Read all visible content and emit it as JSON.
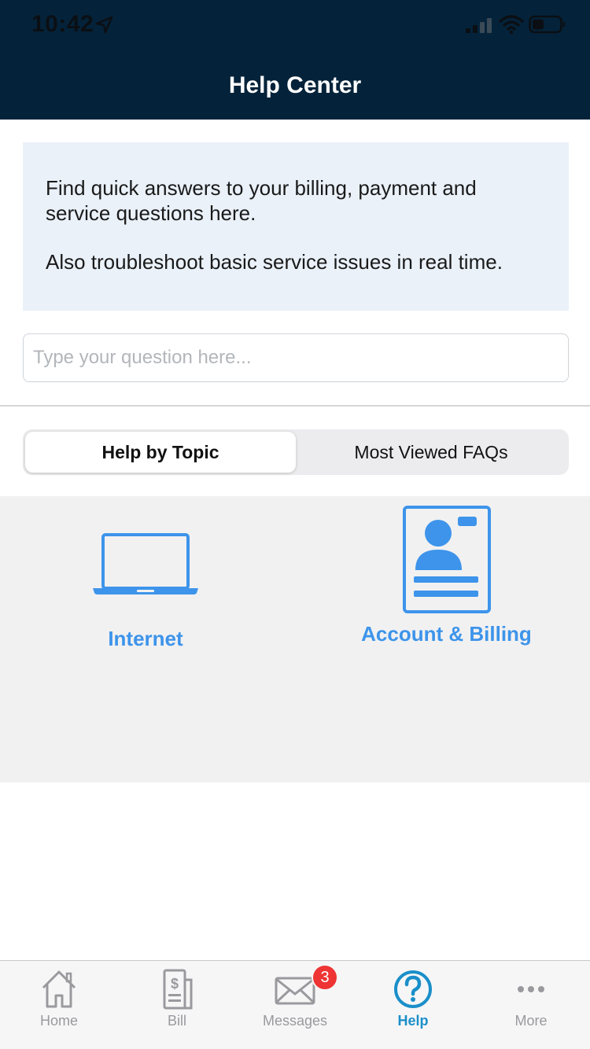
{
  "status_bar": {
    "time": "10:42",
    "icons": [
      "location-arrow-icon",
      "cellular-signal-icon",
      "wifi-icon",
      "battery-icon"
    ]
  },
  "header": {
    "title": "Help Center",
    "background_color": "#04233a"
  },
  "info_box": {
    "paragraph1": "Find quick answers to your billing, payment and service questions here.",
    "paragraph2": "Also troubleshoot basic service issues in real time."
  },
  "search": {
    "placeholder": "Type your question here...",
    "value": ""
  },
  "segmented_control": {
    "options": [
      {
        "label": "Help by Topic",
        "selected": true
      },
      {
        "label": "Most Viewed FAQs",
        "selected": false
      }
    ]
  },
  "topics": [
    {
      "label": "Internet",
      "icon": "laptop-icon"
    },
    {
      "label": "Account & Billing",
      "icon": "id-card-icon"
    }
  ],
  "accent_color": "#3d94ea",
  "tab_bar": {
    "tabs": [
      {
        "label": "Home",
        "icon": "home-icon",
        "active": false
      },
      {
        "label": "Bill",
        "icon": "bill-icon",
        "active": false
      },
      {
        "label": "Messages",
        "icon": "envelope-icon",
        "active": false,
        "badge": "3"
      },
      {
        "label": "Help",
        "icon": "question-circle-icon",
        "active": true
      },
      {
        "label": "More",
        "icon": "more-dots-icon",
        "active": false
      }
    ]
  }
}
